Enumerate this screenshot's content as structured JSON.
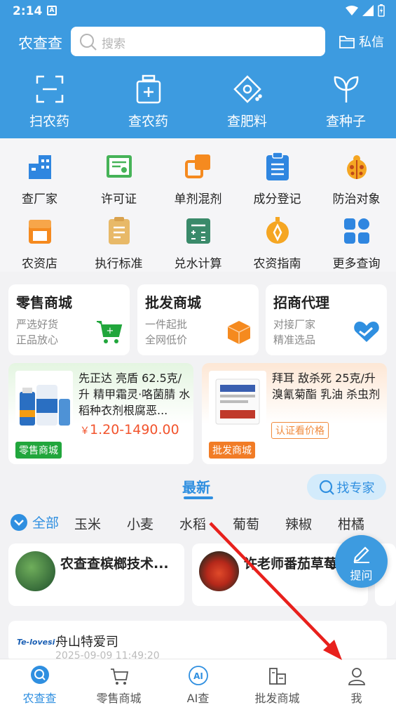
{
  "status": {
    "time": "2:14",
    "notif": "A"
  },
  "header": {
    "brand": "农查查",
    "search_placeholder": "搜索",
    "message_label": "私信"
  },
  "quick": [
    {
      "label": "扫农药",
      "icon": "scan-icon"
    },
    {
      "label": "查农药",
      "icon": "pesticide-bottle-icon"
    },
    {
      "label": "查肥料",
      "icon": "fertilizer-icon"
    },
    {
      "label": "查种子",
      "icon": "seed-icon"
    }
  ],
  "grid": [
    {
      "label": "查厂家",
      "icon": "factory-icon",
      "color": "#2f86e0"
    },
    {
      "label": "许可证",
      "icon": "license-icon",
      "color": "#46b358"
    },
    {
      "label": "单剂混剂",
      "icon": "mix-icon",
      "color": "#f58a1f"
    },
    {
      "label": "成分登记",
      "icon": "clipboard-icon",
      "color": "#2f86e0"
    },
    {
      "label": "防治对象",
      "icon": "ladybug-icon",
      "color": "#f5a623"
    },
    {
      "label": "农资店",
      "icon": "shop-icon",
      "color": "#f58a1f"
    },
    {
      "label": "执行标准",
      "icon": "document-icon",
      "color": "#e8b968"
    },
    {
      "label": "兑水计算",
      "icon": "calculator-icon",
      "color": "#3a8a6a"
    },
    {
      "label": "农资指南",
      "icon": "compass-icon",
      "color": "#f5a623"
    },
    {
      "label": "更多查询",
      "icon": "more-grid-icon",
      "color": "#2f86e0"
    }
  ],
  "malls": [
    {
      "title": "零售商城",
      "line1": "严选好货",
      "line2": "正品放心",
      "icon": "cart-icon"
    },
    {
      "title": "批发商城",
      "line1": "一件起批",
      "line2": "全网低价",
      "icon": "box-icon"
    },
    {
      "title": "招商代理",
      "line1": "对接厂家",
      "line2": "精准选品",
      "icon": "handshake-icon"
    }
  ],
  "products": [
    {
      "name": "先正达 亮盾 62.5克/升 精甲霜灵·咯菌腈 水稻种衣剂根腐恶...",
      "currency": "￥",
      "price": "1.20-1490.00",
      "tag": "零售商城"
    },
    {
      "name": "拜耳 敌杀死 25克/升溴氰菊酯 乳油 杀虫剂",
      "verify": "认证看价格",
      "tag": "批发商城"
    }
  ],
  "feed": {
    "latest_tab": "最新",
    "expert_button": "找专家",
    "all_category": "全部",
    "categories": [
      "玉米",
      "小麦",
      "水稻",
      "葡萄",
      "辣椒",
      "柑橘"
    ]
  },
  "experts": [
    {
      "name": "农查查槟榔技术..."
    },
    {
      "name": "许老师番茄草莓"
    }
  ],
  "post": {
    "logo_text": "Te-lovesi",
    "author": "舟山特爱司",
    "date": "2025-09-09 11:49:20"
  },
  "fab": {
    "label": "提问"
  },
  "bottom_nav": [
    {
      "label": "农查查",
      "icon": "home-search-icon",
      "active": true
    },
    {
      "label": "零售商城",
      "icon": "cart-icon",
      "active": false
    },
    {
      "label": "AI查",
      "icon": "ai-icon",
      "active": false
    },
    {
      "label": "批发商城",
      "icon": "warehouse-icon",
      "active": false
    },
    {
      "label": "我",
      "icon": "user-icon",
      "active": false
    }
  ],
  "colors": {
    "primary": "#3d9be0",
    "price": "#f2542d",
    "green_tag": "#21a63c",
    "orange_tag": "#f17c26"
  }
}
